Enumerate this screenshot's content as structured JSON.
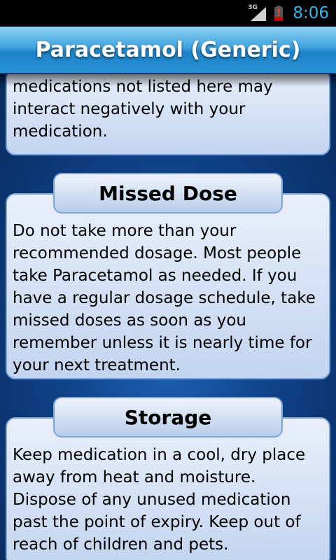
{
  "status_bar": {
    "network_type": "3G",
    "time": "8:06",
    "battery_alert": "!"
  },
  "header": {
    "title": "Paracetamol (Generic)"
  },
  "sections": {
    "interactions": {
      "text_partial": "medications not listed here may interact negatively with your medication."
    },
    "missed_dose": {
      "heading": "Missed Dose",
      "text": "Do not take more than your recommended dosage.  Most people take Paracetamol as needed. If you have a regular dosage schedule, take missed doses as soon as you remember unless it is nearly time for your next treatment."
    },
    "storage": {
      "heading": "Storage",
      "text": "Keep medication in a cool, dry place away from heat and moisture. Dispose of any unused medication past the point of expiry. Keep out of reach of children and pets."
    }
  },
  "colors": {
    "status_time": "#33b5e5",
    "title_bar": "#2891d3",
    "background": "#0f4289",
    "card": "#c2d4ef",
    "card_border": "#7ea3d8"
  },
  "icons": {
    "signal": "signal-icon",
    "battery": "battery-alert-icon"
  }
}
